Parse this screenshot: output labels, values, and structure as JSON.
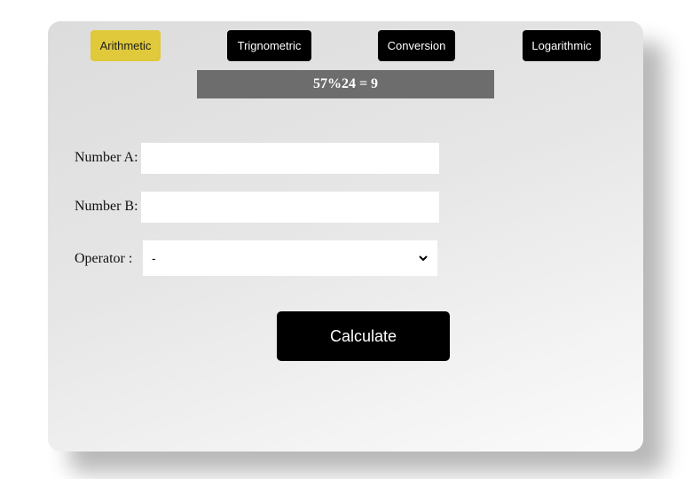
{
  "tabs": [
    {
      "label": "Arithmetic",
      "active": true
    },
    {
      "label": "Trignometric",
      "active": false
    },
    {
      "label": "Conversion",
      "active": false
    },
    {
      "label": "Logarithmic",
      "active": false
    }
  ],
  "result": {
    "text": "57%24 = 9"
  },
  "form": {
    "number_a": {
      "label": "Number A:",
      "value": ""
    },
    "number_b": {
      "label": "Number B:",
      "value": ""
    },
    "operator": {
      "label": "Operator :",
      "selected": "-"
    }
  },
  "calculate_button": {
    "label": "Calculate"
  },
  "colors": {
    "active_tab": "#e0c93a",
    "tab": "#000000",
    "result_bar": "#6d6d6d"
  }
}
